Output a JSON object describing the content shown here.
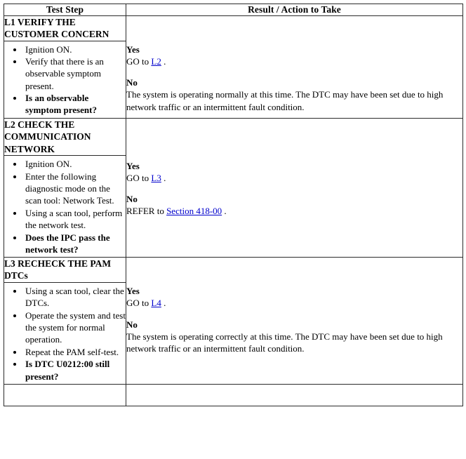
{
  "table": {
    "headers": {
      "test_step": "Test Step",
      "result_action": "Result / Action to Take"
    },
    "steps": [
      {
        "id": "L1",
        "title": "L1 VERIFY THE CUSTOMER CONCERN",
        "bullets": [
          {
            "text": "Ignition ON.",
            "bold": false
          },
          {
            "text": "Verify that there is an observable symptom present.",
            "bold": false
          },
          {
            "text": "Is an observable symptom present?",
            "bold": true
          }
        ],
        "result": {
          "yes_label": "Yes",
          "yes_prefix": "GO to ",
          "yes_link": "L2",
          "yes_suffix": " .",
          "no_label": "No",
          "no_text": "The system is operating normally at this time. The DTC may have been set due to high network traffic or an intermittent fault condition.",
          "no_link": "",
          "no_prefix": "",
          "no_suffix": ""
        }
      },
      {
        "id": "L2",
        "title": "L2 CHECK THE COMMUNICATION NETWORK",
        "bullets": [
          {
            "text": "Ignition ON.",
            "bold": false
          },
          {
            "text": "Enter the following diagnostic mode on the scan tool: Network Test.",
            "bold": false
          },
          {
            "text": "Using a scan tool, perform the network test.",
            "bold": false
          },
          {
            "text": "Does the IPC pass the network test?",
            "bold": true
          }
        ],
        "result": {
          "yes_label": "Yes",
          "yes_prefix": "GO to ",
          "yes_link": "L3",
          "yes_suffix": " .",
          "no_label": "No",
          "no_text": "",
          "no_prefix": "REFER to ",
          "no_link": "Section 418-00",
          "no_suffix": " ."
        }
      },
      {
        "id": "L3",
        "title": "L3 RECHECK THE PAM DTCs",
        "bullets": [
          {
            "text": "Using a scan tool, clear the DTCs.",
            "bold": false
          },
          {
            "text": "Operate the system and test the system for normal operation.",
            "bold": false
          },
          {
            "text": "Repeat the PAM self-test.",
            "bold": false
          },
          {
            "text": "Is DTC U0212:00 still present?",
            "bold": true
          }
        ],
        "result": {
          "yes_label": "Yes",
          "yes_prefix": "GO to ",
          "yes_link": "L4",
          "yes_suffix": " .",
          "no_label": "No",
          "no_text": "The system is operating correctly at this time. The DTC may have been set due to high network traffic or an intermittent fault condition.",
          "no_link": "",
          "no_prefix": "",
          "no_suffix": ""
        }
      }
    ],
    "colors": {
      "border": "#2b2b2b",
      "link": "#0000cc",
      "text": "#000000"
    }
  }
}
